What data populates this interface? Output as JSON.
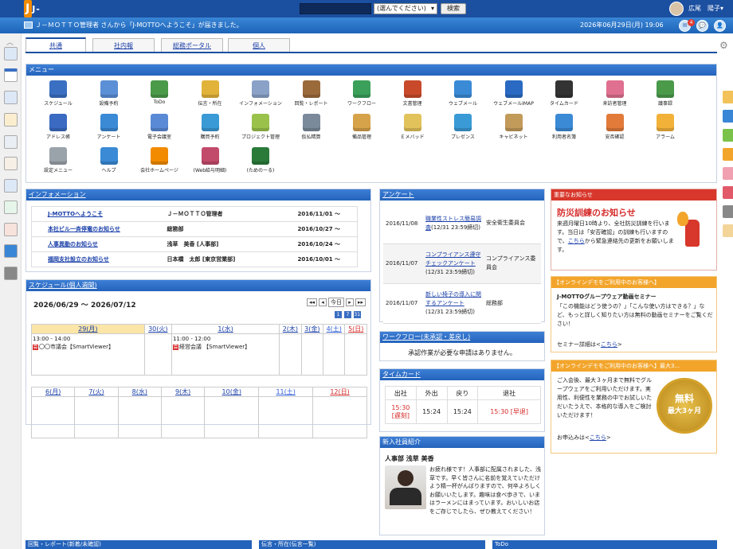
{
  "header": {
    "logo": "J-MOTTO",
    "select_placeholder": "(選んでください)",
    "search_label": "検索",
    "user_name": "広尾　陽子▾"
  },
  "notification": {
    "text": "Ｊ－ＭＯＴＴＯ管理者 さんから「J-MOTTOへようこそ」が届きました。",
    "datetime": "2026年06月29日(月) 19:06",
    "badge": "4"
  },
  "tabs": [
    {
      "label": "共通"
    },
    {
      "label": "社内報"
    },
    {
      "label": "総務ポータル"
    },
    {
      "label": "個人"
    }
  ],
  "menu": {
    "title": "メニュー",
    "items": [
      {
        "label": "スケジュール",
        "icon": "calendar-icon",
        "color": "#3b6fc2"
      },
      {
        "label": "設備予約",
        "icon": "facility-icon",
        "color": "#5b8fd6"
      },
      {
        "label": "ToDo",
        "icon": "todo-icon",
        "color": "#4a9a4a"
      },
      {
        "label": "伝言・所在",
        "icon": "memo-icon",
        "color": "#e2b33a"
      },
      {
        "label": "インフォメーション",
        "icon": "info-icon",
        "color": "#8aa2c8"
      },
      {
        "label": "回覧・レポート",
        "icon": "report-icon",
        "color": "#9a6a3a"
      },
      {
        "label": "ワークフロー",
        "icon": "workflow-icon",
        "color": "#3aa05a"
      },
      {
        "label": "文書管理",
        "icon": "document-icon",
        "color": "#c84a2a"
      },
      {
        "label": "ウェブメール",
        "icon": "webmail-icon",
        "color": "#3a8ad6"
      },
      {
        "label": "ウェブメールIMAP",
        "icon": "webmail-imap-icon",
        "color": "#2a6ac2"
      },
      {
        "label": "タイムカード",
        "icon": "timecard-icon",
        "color": "#333333"
      },
      {
        "label": "来訪者管理",
        "icon": "visitor-icon",
        "color": "#e07090"
      },
      {
        "label": "議事録",
        "icon": "minutes-icon",
        "color": "#4a9a4a"
      },
      {
        "label": "アドレス帳",
        "icon": "address-book-icon",
        "color": "#3a6ac2"
      },
      {
        "label": "アンケート",
        "icon": "survey-icon",
        "color": "#3a8ad6"
      },
      {
        "label": "電子会議室",
        "icon": "meeting-room-icon",
        "color": "#5a8ad6"
      },
      {
        "label": "購買予約",
        "icon": "shopping-cart-icon",
        "color": "#3a9ad6"
      },
      {
        "label": "プロジェクト管理",
        "icon": "project-icon",
        "color": "#9ac24a"
      },
      {
        "label": "仮払精算",
        "icon": "calculator-icon",
        "color": "#7a8a9a"
      },
      {
        "label": "備品管理",
        "icon": "box-icon",
        "color": "#d6a24a"
      },
      {
        "label": "Ｅメバッド",
        "icon": "memo-pad-icon",
        "color": "#e2c25a"
      },
      {
        "label": "プレゼンス",
        "icon": "presence-icon",
        "color": "#3a9ad6"
      },
      {
        "label": "キャビネット",
        "icon": "cabinet-icon",
        "color": "#c29a5a"
      },
      {
        "label": "利用者名簿",
        "icon": "user-list-icon",
        "color": "#3a8ad6"
      },
      {
        "label": "安否確認",
        "icon": "safety-icon",
        "color": "#e27a3a"
      },
      {
        "label": "アラーム",
        "icon": "alarm-bell-icon",
        "color": "#f2b23a"
      },
      {
        "label": "設定メニュー",
        "icon": "settings-list-icon",
        "color": "#9aa2aa"
      },
      {
        "label": "ヘルプ",
        "icon": "help-icon",
        "color": "#3a8ad6"
      },
      {
        "label": "会社ホームページ",
        "icon": "company-logo-icon",
        "color": "#f38b00"
      },
      {
        "label": "(Web給与明細)",
        "icon": "sample-flask-icon",
        "color": "#c24a6a"
      },
      {
        "label": "(ためのーる)",
        "icon": "tamenoru-icon",
        "color": "#2a7a3a"
      }
    ]
  },
  "information": {
    "title": "インフォメーション",
    "rows": [
      {
        "title": "J-MOTTOへようこそ",
        "author": "Ｊ－ＭＯＴＴＯ管理者",
        "date": "2016/11/01 ～"
      },
      {
        "title": "本社ビル一斉停電のお知らせ",
        "author": "総務部",
        "date": "2016/10/27 ～"
      },
      {
        "title": "人事異動のお知らせ",
        "author": "浅草　美香 [人事部]",
        "date": "2016/10/24 ～"
      },
      {
        "title": "福岡支社設立のお知らせ",
        "author": "日本橋　太郎 [東京営業部]",
        "date": "2016/10/01 ～"
      }
    ]
  },
  "schedule": {
    "title": "スケジュール(個人週間)",
    "range": "2026/06/29 ～ 2026/07/12",
    "today_label": "今日",
    "week1": [
      "29(月)",
      "30(火)",
      "1(水)",
      "2(木)",
      "3(金)",
      "4(土)",
      "5(日)"
    ],
    "week2": [
      "6(月)",
      "7(火)",
      "8(水)",
      "9(木)",
      "10(金)",
      "11(土)",
      "12(日)"
    ],
    "events": [
      {
        "time": "13:00 - 14:00",
        "title": "〇〇市議会【SmartViewer】",
        "tag": "会"
      },
      {
        "time": "11:00 - 12:00",
        "title": "経営会議 【SmartViewer】",
        "tag": "会"
      }
    ]
  },
  "survey": {
    "title": "アンケート",
    "rows": [
      {
        "date": "2016/11/08",
        "title": "職業性ストレス簡易調査",
        "deadline": "(12/31 23:59締切)",
        "author": "安全衛生委員会"
      },
      {
        "date": "2016/11/07",
        "title": "コンプライアンス遵守チェックアンケート",
        "deadline": "(12/31 23:59締切)",
        "author": "コンプライアンス委員会"
      },
      {
        "date": "2016/11/07",
        "title": "新しい椅子の導入に関するアンケート",
        "deadline": "(12/31 23:59締切)",
        "author": "総務部"
      }
    ]
  },
  "workflow": {
    "title": "ワークフロー(未承認・差戻し)",
    "message": "承認作業が必要な申請はありません。"
  },
  "timecard": {
    "title": "タイムカード",
    "headers": [
      "出社",
      "外出",
      "戻り",
      "退社"
    ],
    "values": [
      "15:30",
      "15:24",
      "15:24",
      "15:30"
    ],
    "tags": [
      "[遅刻]",
      "[早退]"
    ]
  },
  "new_employee": {
    "title": "新入社員紹介",
    "name": "人事部 浅草 美香",
    "text": "お疲れ様です！人事部に配属されました、浅草です。早く皆さんに名前を覚えていただけよう精一杯がんばりますので、何卒よろしくお願いいたします。趣味は食べ歩きで、いまはラーメンにはまっています。おいしいお店をご存じでしたら、ぜひ教えてください！"
  },
  "important": {
    "title": "重要なお知らせ",
    "heading": "防災訓練のお知らせ",
    "body": "来週月曜日10時より、全社防災訓練を行います。当日は「安否確認」の訓練も行いますので、",
    "link": "こちら",
    "tail": "から緊急連絡先の更新をお願いします。"
  },
  "demo": {
    "title": "【オンラインデモをご利用中のお客様へ】",
    "heading": "J-MOTTOグループウェア動画セミナー",
    "body": "「この機能はどう使うの？」「こんな使い方はできる？」など、もっと詳しく知りたい方は無料の動画セミナーをご覧ください！",
    "detail": "セミナー詳細は<",
    "link": "こちら",
    "close": ">"
  },
  "free": {
    "title": "【オンラインデモをご利用中のお客様へ】最大3...",
    "body": "ご入会後、最大３ヶ月まで無料でグループウェアをご利用いただけます。実用性、利便性を業務の中でお試しいただいたうえで、本格的な導入をご検討いただけます！",
    "apply": "お申込みは<",
    "link": "こちら",
    "close": ">",
    "badge_top": "無料",
    "badge_bottom": "最大3ヶ月"
  },
  "bottom": [
    "回覧・レポート(新着/未確認)",
    "伝言・所在(伝言一覧)",
    "ToDo"
  ]
}
